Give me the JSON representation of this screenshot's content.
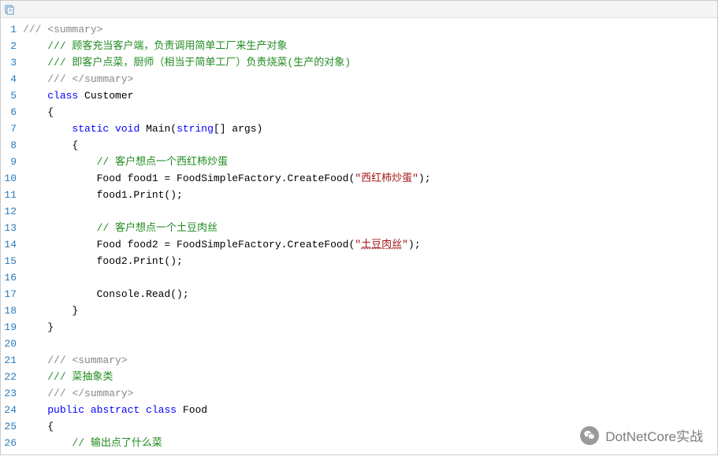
{
  "watermark": {
    "text": "DotNetCore实战"
  },
  "toolbar": {
    "copy_icon": "copy-icon"
  },
  "code": {
    "lines": [
      {
        "n": 1,
        "tokens": [
          {
            "t": "/// ",
            "c": "c-gray"
          },
          {
            "t": "<summary>",
            "c": "c-gray"
          }
        ]
      },
      {
        "n": 2,
        "tokens": [
          {
            "t": "    ",
            "c": "c-black"
          },
          {
            "t": "/// 顾客充当客户端，负责调用简单工厂来生产对象",
            "c": "c-green"
          }
        ]
      },
      {
        "n": 3,
        "tokens": [
          {
            "t": "    ",
            "c": "c-black"
          },
          {
            "t": "/// 即客户点菜，厨师（相当于简单工厂）负责烧菜(生产的对象)",
            "c": "c-green"
          }
        ]
      },
      {
        "n": 4,
        "tokens": [
          {
            "t": "    ",
            "c": "c-black"
          },
          {
            "t": "/// ",
            "c": "c-gray"
          },
          {
            "t": "</summary>",
            "c": "c-gray"
          }
        ]
      },
      {
        "n": 5,
        "tokens": [
          {
            "t": "    ",
            "c": "c-black"
          },
          {
            "t": "class",
            "c": "c-blue"
          },
          {
            "t": " Customer",
            "c": "c-black"
          }
        ]
      },
      {
        "n": 6,
        "tokens": [
          {
            "t": "    {",
            "c": "c-black"
          }
        ]
      },
      {
        "n": 7,
        "tokens": [
          {
            "t": "        ",
            "c": "c-black"
          },
          {
            "t": "static",
            "c": "c-blue"
          },
          {
            "t": " ",
            "c": "c-black"
          },
          {
            "t": "void",
            "c": "c-blue"
          },
          {
            "t": " Main(",
            "c": "c-black"
          },
          {
            "t": "string",
            "c": "c-blue"
          },
          {
            "t": "[] args)",
            "c": "c-black"
          }
        ]
      },
      {
        "n": 8,
        "tokens": [
          {
            "t": "        {",
            "c": "c-black"
          }
        ]
      },
      {
        "n": 9,
        "tokens": [
          {
            "t": "            ",
            "c": "c-black"
          },
          {
            "t": "// 客户想点一个西红柿炒蛋",
            "c": "c-green"
          }
        ]
      },
      {
        "n": 10,
        "tokens": [
          {
            "t": "            Food food1 = FoodSimpleFactory.CreateFood(",
            "c": "c-black"
          },
          {
            "t": "\"",
            "c": "c-maroon"
          },
          {
            "t": "西红柿炒蛋",
            "c": "c-maroon"
          },
          {
            "t": "\"",
            "c": "c-maroon"
          },
          {
            "t": ");",
            "c": "c-black"
          }
        ]
      },
      {
        "n": 11,
        "tokens": [
          {
            "t": "            food1.Print();",
            "c": "c-black"
          }
        ]
      },
      {
        "n": 12,
        "tokens": [
          {
            "t": "",
            "c": "c-black"
          }
        ]
      },
      {
        "n": 13,
        "tokens": [
          {
            "t": "            ",
            "c": "c-black"
          },
          {
            "t": "// 客户想点一个土豆肉丝",
            "c": "c-green"
          }
        ]
      },
      {
        "n": 14,
        "tokens": [
          {
            "t": "            Food food2 = FoodSimpleFactory.CreateFood(",
            "c": "c-black"
          },
          {
            "t": "\"",
            "c": "c-maroon"
          },
          {
            "t": "土豆肉丝",
            "c": "c-maroon underline"
          },
          {
            "t": "\"",
            "c": "c-maroon"
          },
          {
            "t": ");",
            "c": "c-black"
          }
        ]
      },
      {
        "n": 15,
        "tokens": [
          {
            "t": "            food2.Print();",
            "c": "c-black"
          }
        ]
      },
      {
        "n": 16,
        "tokens": [
          {
            "t": "",
            "c": "c-black"
          }
        ]
      },
      {
        "n": 17,
        "tokens": [
          {
            "t": "            Console.Read();",
            "c": "c-black"
          }
        ]
      },
      {
        "n": 18,
        "tokens": [
          {
            "t": "        }",
            "c": "c-black"
          }
        ]
      },
      {
        "n": 19,
        "tokens": [
          {
            "t": "    }",
            "c": "c-black"
          }
        ]
      },
      {
        "n": 20,
        "tokens": [
          {
            "t": "",
            "c": "c-black"
          }
        ]
      },
      {
        "n": 21,
        "tokens": [
          {
            "t": "    ",
            "c": "c-black"
          },
          {
            "t": "/// ",
            "c": "c-gray"
          },
          {
            "t": "<summary>",
            "c": "c-gray"
          }
        ]
      },
      {
        "n": 22,
        "tokens": [
          {
            "t": "    ",
            "c": "c-black"
          },
          {
            "t": "/// 菜抽象类",
            "c": "c-green"
          }
        ]
      },
      {
        "n": 23,
        "tokens": [
          {
            "t": "    ",
            "c": "c-black"
          },
          {
            "t": "/// ",
            "c": "c-gray"
          },
          {
            "t": "</summary>",
            "c": "c-gray"
          }
        ]
      },
      {
        "n": 24,
        "tokens": [
          {
            "t": "    ",
            "c": "c-black"
          },
          {
            "t": "public",
            "c": "c-blue"
          },
          {
            "t": " ",
            "c": "c-black"
          },
          {
            "t": "abstract",
            "c": "c-blue"
          },
          {
            "t": " ",
            "c": "c-black"
          },
          {
            "t": "class",
            "c": "c-blue"
          },
          {
            "t": " Food",
            "c": "c-black"
          }
        ]
      },
      {
        "n": 25,
        "tokens": [
          {
            "t": "    {",
            "c": "c-black"
          }
        ]
      },
      {
        "n": 26,
        "tokens": [
          {
            "t": "        ",
            "c": "c-black"
          },
          {
            "t": "// 输出点了什么菜",
            "c": "c-green"
          }
        ]
      }
    ]
  }
}
